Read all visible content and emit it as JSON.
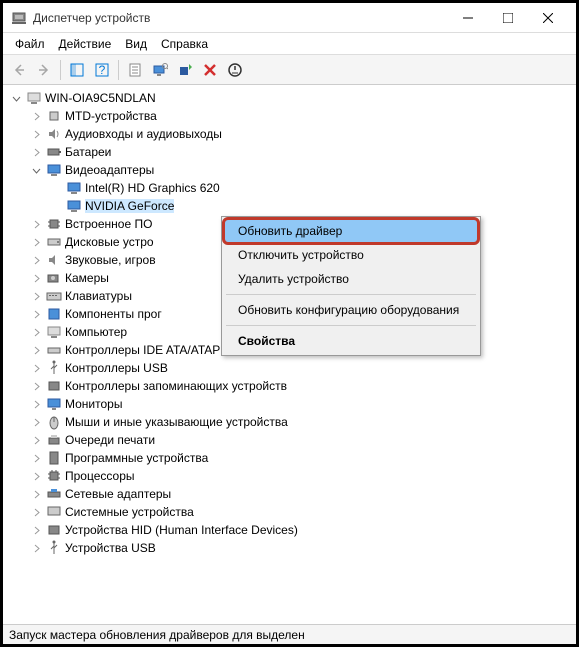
{
  "window": {
    "title": "Диспетчер устройств"
  },
  "menu": {
    "file": "Файл",
    "action": "Действие",
    "view": "Вид",
    "help": "Справка"
  },
  "tree": {
    "root": "WIN-OIA9C5NDLAN",
    "mtd": "MTD-устройства",
    "audio": "Аудиовходы и аудиовыходы",
    "batteries": "Батареи",
    "display": "Видеоадаптеры",
    "intel_hd": "Intel(R) HD Graphics 620",
    "nvidia": "NVIDIA GeForce",
    "firmware": "Встроенное ПО",
    "disk": "Дисковые устро",
    "sound": "Звуковые, игров",
    "cameras": "Камеры",
    "keyboards": "Клавиатуры",
    "software_comp": "Компоненты прог",
    "computer": "Компьютер",
    "ide": "Контроллеры IDE ATA/ATAPI",
    "usb_ctrl": "Контроллеры USB",
    "storage_ctrl": "Контроллеры запоминающих устройств",
    "monitors": "Мониторы",
    "mice": "Мыши и иные указывающие устройства",
    "print_queue": "Очереди печати",
    "software_dev": "Программные устройства",
    "processors": "Процессоры",
    "net": "Сетевые адаптеры",
    "system": "Системные устройства",
    "hid": "Устройства HID (Human Interface Devices)",
    "usb_dev": "Устройства USB"
  },
  "context": {
    "update": "Обновить драйвер",
    "disable": "Отключить устройство",
    "remove": "Удалить устройство",
    "scan": "Обновить конфигурацию оборудования",
    "properties": "Свойства"
  },
  "status": {
    "text": "Запуск мастера обновления драйверов для выделен"
  }
}
